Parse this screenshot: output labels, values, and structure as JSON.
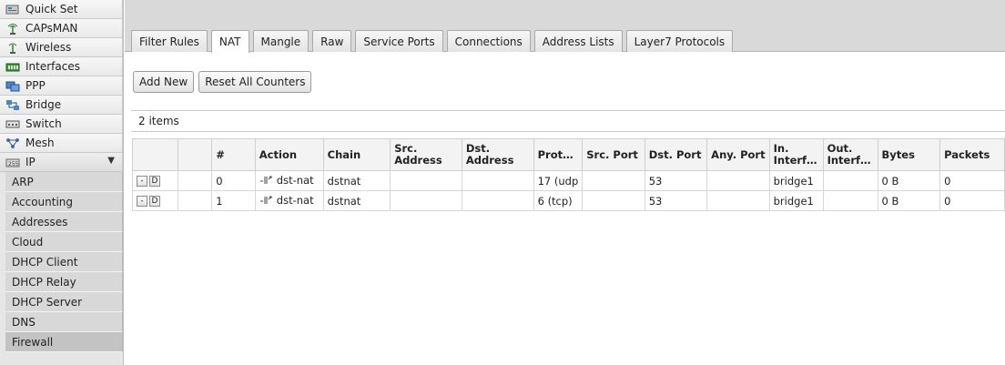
{
  "sidebar": {
    "menu": [
      {
        "label": "Quick Set",
        "icon": "quick-set-icon"
      },
      {
        "label": "CAPsMAN",
        "icon": "capsman-icon"
      },
      {
        "label": "Wireless",
        "icon": "wireless-icon"
      },
      {
        "label": "Interfaces",
        "icon": "interfaces-icon"
      },
      {
        "label": "PPP",
        "icon": "ppp-icon"
      },
      {
        "label": "Bridge",
        "icon": "bridge-icon"
      },
      {
        "label": "Switch",
        "icon": "switch-icon"
      },
      {
        "label": "Mesh",
        "icon": "mesh-icon"
      },
      {
        "label": "IP",
        "icon": "ip-icon",
        "arrow": "▼"
      }
    ],
    "ip_submenu": [
      "ARP",
      "Accounting",
      "Addresses",
      "Cloud",
      "DHCP Client",
      "DHCP Relay",
      "DHCP Server",
      "DNS",
      "Firewall"
    ],
    "active_submenu": "Firewall"
  },
  "tabs": [
    "Filter Rules",
    "NAT",
    "Mangle",
    "Raw",
    "Service Ports",
    "Connections",
    "Address Lists",
    "Layer7 Protocols"
  ],
  "active_tab": "NAT",
  "toolbar": {
    "add_new": "Add New",
    "reset_counters": "Reset All Counters"
  },
  "item_count": "2 items",
  "table": {
    "headers": [
      "",
      "",
      "#",
      "Action",
      "Chain",
      "Src. Address",
      "Dst. Address",
      "Prot…",
      "Src. Port",
      "Dst. Port",
      "Any. Port",
      "In. Interf…",
      "Out. Interf…",
      "Bytes",
      "Packets"
    ],
    "row_buttons": {
      "remove": "-",
      "disable": "D"
    },
    "rows": [
      {
        "num": "0",
        "action": "dst-nat",
        "chain": "dstnat",
        "src_address": "",
        "dst_address": "",
        "protocol": "17 (udp",
        "src_port": "",
        "dst_port": "53",
        "any_port": "",
        "in_interface": "bridge1",
        "out_interface": "",
        "bytes": "0 B",
        "packets": "0"
      },
      {
        "num": "1",
        "action": "dst-nat",
        "chain": "dstnat",
        "src_address": "",
        "dst_address": "",
        "protocol": "6 (tcp)",
        "src_port": "",
        "dst_port": "53",
        "any_port": "",
        "in_interface": "bridge1",
        "out_interface": "",
        "bytes": "0 B",
        "packets": "0"
      }
    ]
  }
}
